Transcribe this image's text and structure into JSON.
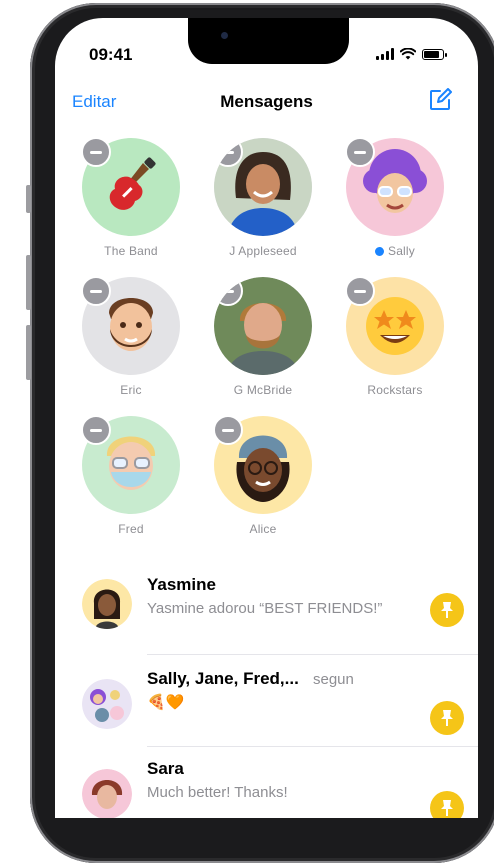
{
  "status_bar": {
    "time": "09:41"
  },
  "nav": {
    "edit_label": "Editar",
    "title": "Mensagens",
    "compose_icon": "compose-icon"
  },
  "pinned": [
    {
      "name": "The Band",
      "bg": "#b9e8c0",
      "icon": "guitar-memoji",
      "unread": false
    },
    {
      "name": "J Appleseed",
      "bg": "#d8d8dc",
      "icon": "person-photo",
      "unread": false
    },
    {
      "name": "Sally",
      "bg": "#f6c7d8",
      "icon": "memoji-purple-hair",
      "unread": true
    },
    {
      "name": "Eric",
      "bg": "#e3e3e6",
      "icon": "memoji-bearded",
      "unread": false
    },
    {
      "name": "G McBride",
      "bg": "#cfcfd2",
      "icon": "person-photo",
      "unread": false
    },
    {
      "name": "Rockstars",
      "bg": "#fde2a6",
      "icon": "star-eyes-emoji",
      "unread": false
    },
    {
      "name": "Fred",
      "bg": "#c8ebcf",
      "icon": "memoji-mask",
      "unread": false
    },
    {
      "name": "Alice",
      "bg": "#fde7a6",
      "icon": "memoji-beanie",
      "unread": false
    }
  ],
  "conversations": [
    {
      "name": "Yasmine",
      "time": "",
      "preview": "Yasmine adorou “BEST FRIENDS!”",
      "avatar_bg": "#fde7a6"
    },
    {
      "name": "Sally, Jane, Fred,...",
      "time": "segun",
      "preview": "🍕🧡",
      "avatar_bg": "#e9e4f4"
    },
    {
      "name": "Sara",
      "time": "",
      "preview": "Much better! Thanks!",
      "avatar_bg": "#f6c7d8"
    }
  ],
  "colors": {
    "accent": "#1a84ff",
    "pin_badge": "#f5c518",
    "unread_dot": "#1a84ff"
  }
}
